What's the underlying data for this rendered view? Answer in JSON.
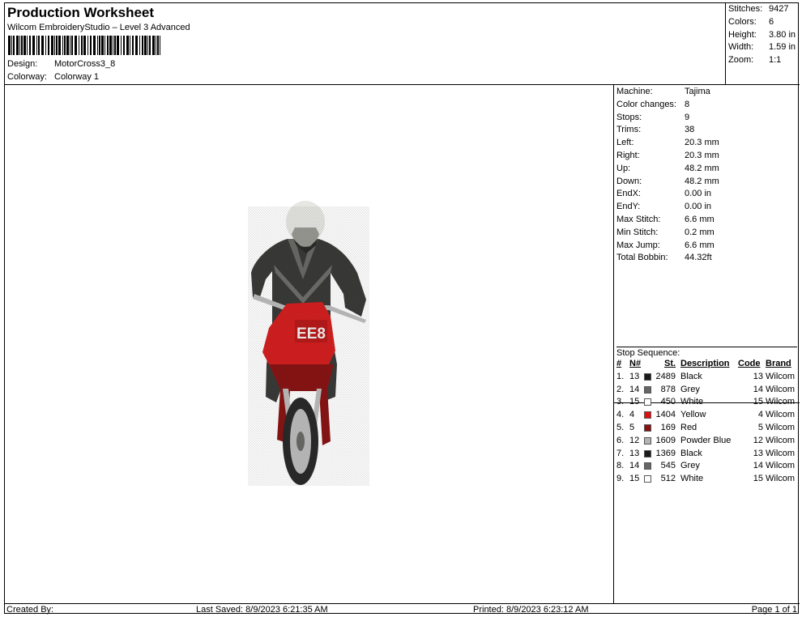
{
  "header": {
    "title": "Production Worksheet",
    "software": "Wilcom EmbroideryStudio – Level 3 Advanced",
    "design_label": "Design:",
    "design_value": "MotorCross3_8",
    "colorway_label": "Colorway:",
    "colorway_value": "Colorway 1"
  },
  "summary": [
    {
      "label": "Stitches:",
      "value": "9427"
    },
    {
      "label": "Colors:",
      "value": "6"
    },
    {
      "label": "Height:",
      "value": "3.80 in"
    },
    {
      "label": "Width:",
      "value": "1.59 in"
    },
    {
      "label": "Zoom:",
      "value": "1:1"
    }
  ],
  "details": [
    {
      "label": "Machine:",
      "value": "Tajima"
    },
    {
      "label": "Color changes:",
      "value": "8"
    },
    {
      "label": "Stops:",
      "value": "9"
    },
    {
      "label": "Trims:",
      "value": "38"
    },
    {
      "label": "Left:",
      "value": "20.3 mm"
    },
    {
      "label": "Right:",
      "value": "20.3 mm"
    },
    {
      "label": "Up:",
      "value": "48.2 mm"
    },
    {
      "label": "Down:",
      "value": "48.2 mm"
    },
    {
      "label": "EndX:",
      "value": "0.00 in"
    },
    {
      "label": "EndY:",
      "value": "0.00 in"
    },
    {
      "label": "Max Stitch:",
      "value": "6.6 mm"
    },
    {
      "label": "Min Stitch:",
      "value": "0.2 mm"
    },
    {
      "label": "Max Jump:",
      "value": "6.6 mm"
    },
    {
      "label": "Total Bobbin:",
      "value": "44.32ft"
    }
  ],
  "stop_sequence": {
    "title": "Stop Sequence:",
    "columns": [
      "#",
      "N#",
      "St.",
      "Description",
      "Code",
      "Brand"
    ],
    "rows": [
      {
        "num": "1.",
        "n": "13",
        "color": "#1a1a1a",
        "st": "2489",
        "desc": "Black",
        "code": "13",
        "brand": "Wilcom"
      },
      {
        "num": "2.",
        "n": "14",
        "color": "#666666",
        "st": "878",
        "desc": "Grey",
        "code": "14",
        "brand": "Wilcom"
      },
      {
        "num": "3.",
        "n": "15",
        "color": "#ffffff",
        "st": "450",
        "desc": "White",
        "code": "15",
        "brand": "Wilcom"
      },
      {
        "num": "4.",
        "n": "4",
        "color": "#e01010",
        "st": "1404",
        "desc": "Yellow",
        "code": "4",
        "brand": "Wilcom"
      },
      {
        "num": "5.",
        "n": "5",
        "color": "#8a0f0f",
        "st": "169",
        "desc": "Red",
        "code": "5",
        "brand": "Wilcom"
      },
      {
        "num": "6.",
        "n": "12",
        "color": "#b4b4b4",
        "st": "1609",
        "desc": "Powder Blue",
        "code": "12",
        "brand": "Wilcom"
      },
      {
        "num": "7.",
        "n": "13",
        "color": "#1a1a1a",
        "st": "1369",
        "desc": "Black",
        "code": "13",
        "brand": "Wilcom"
      },
      {
        "num": "8.",
        "n": "14",
        "color": "#666666",
        "st": "545",
        "desc": "Grey",
        "code": "14",
        "brand": "Wilcom"
      },
      {
        "num": "9.",
        "n": "15",
        "color": "#ffffff",
        "st": "512",
        "desc": "White",
        "code": "15",
        "brand": "Wilcom"
      }
    ]
  },
  "design_preview": {
    "plate_number": "EE8",
    "colors": {
      "jacket": "#3a3a38",
      "helmet": "#e6e6e2",
      "bike": "#d42020",
      "tire": "#2a2a2a",
      "rim": "#bdbdbd"
    }
  },
  "footer": {
    "created_by": "Created By:",
    "last_saved": "Last Saved: 8/9/2023 6:21:35 AM",
    "printed": "Printed: 8/9/2023 6:23:12 AM",
    "page": "Page 1 of 1"
  }
}
